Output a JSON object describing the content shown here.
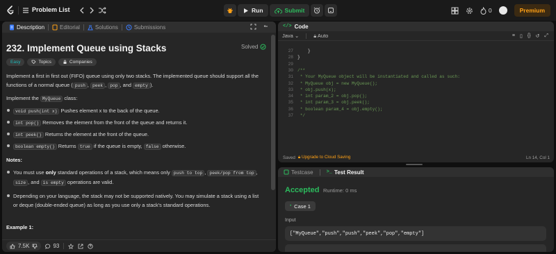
{
  "topbar": {
    "problem_list_label": "Problem List",
    "run_label": "Run",
    "submit_label": "Submit",
    "streak_count": "0",
    "premium_label": "Premium"
  },
  "description": {
    "tabs": [
      "Description",
      "Editorial",
      "Solutions",
      "Submissions"
    ],
    "title": "232. Implement Queue using Stacks",
    "status": "Solved",
    "chips": [
      "Easy",
      "Topics",
      "Companies"
    ],
    "intro_a": "Implement a first in first out (FIFO) queue using only two stacks. The implemented queue should support all the functions of a normal queue (",
    "intro_codes": [
      "push",
      "peek",
      "pop",
      "empty"
    ],
    "intro_b": ").",
    "impl_a": "Implement the ",
    "impl_code": "MyQueue",
    "impl_b": " class:",
    "methods": [
      {
        "code": "void push(int x)",
        "text": " Pushes element x to the back of the queue."
      },
      {
        "code": "int pop()",
        "text": " Removes the element from the front of the queue and returns it."
      },
      {
        "code": "int peek()",
        "text": " Returns the element at the front of the queue."
      },
      {
        "code": "boolean empty()",
        "text": " Returns ",
        "code2": "true",
        "text2": " if the queue is empty, ",
        "code3": "false",
        "text3": " otherwise."
      }
    ],
    "notes_heading": "Notes:",
    "note1_a": "You must use ",
    "note1_bold": "only",
    "note1_b": " standard operations of a stack, which means only ",
    "note1_codes": [
      "push to top",
      "peek/pop from top",
      "size",
      "is empty"
    ],
    "note1_c": " operations are valid.",
    "note2": "Depending on your language, the stack may not be supported natively. You may simulate a stack using a list or deque (double-ended queue) as long as you use only a stack's standard operations.",
    "example_heading": "Example 1:",
    "likes": "7.5K",
    "comments": "93"
  },
  "code": {
    "title": "Code",
    "language": "Java",
    "mode": "Auto",
    "lines": [
      {
        "n": "27",
        "t": "    }",
        "c": false
      },
      {
        "n": "28",
        "t": "}",
        "c": false
      },
      {
        "n": "29",
        "t": "",
        "c": false
      },
      {
        "n": "30",
        "t": "/**",
        "c": true
      },
      {
        "n": "31",
        "t": " * Your MyQueue object will be instantiated and called as such:",
        "c": true
      },
      {
        "n": "32",
        "t": " * MyQueue obj = new MyQueue();",
        "c": true
      },
      {
        "n": "33",
        "t": " * obj.push(x);",
        "c": true
      },
      {
        "n": "34",
        "t": " * int param_2 = obj.pop();",
        "c": true
      },
      {
        "n": "35",
        "t": " * int param_3 = obj.peek();",
        "c": true
      },
      {
        "n": "36",
        "t": " * boolean param_4 = obj.empty();",
        "c": true
      },
      {
        "n": "37",
        "t": " */",
        "c": true
      }
    ],
    "saved_label": "Saved",
    "upgrade_label": "Upgrade to Cloud Saving",
    "cursor": "Ln 14, Col 1"
  },
  "test": {
    "tabs": [
      "Testcase",
      "Test Result"
    ],
    "status": "Accepted",
    "runtime": "Runtime: 0 ms",
    "case_label": "Case 1",
    "input_label": "Input",
    "input_value": "[\"MyQueue\",\"push\",\"push\",\"peek\",\"pop\",\"empty\"]"
  },
  "colors": {
    "accent": "#ffa116",
    "success": "#2cbb5d",
    "easy": "#1cbaba"
  }
}
